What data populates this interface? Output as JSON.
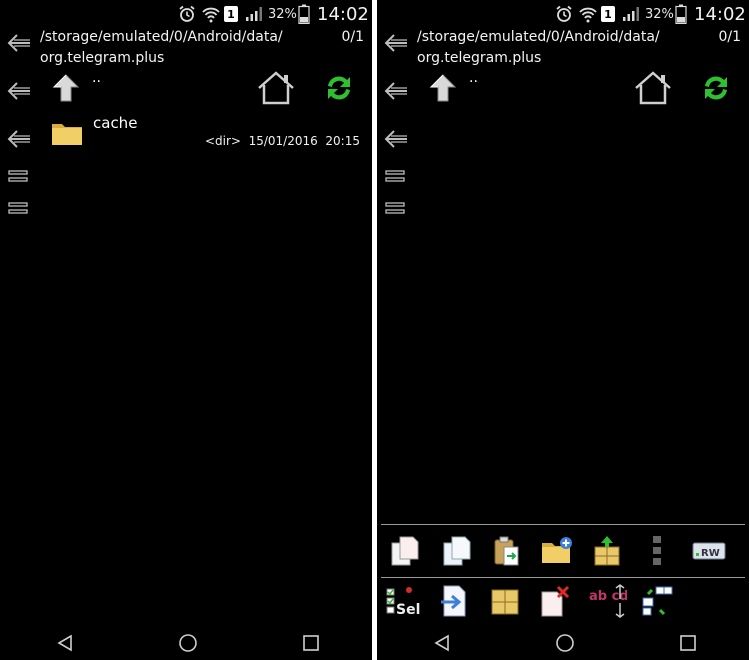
{
  "status_bar": {
    "battery_percent": "32%",
    "time": "14:02",
    "sim_label": "1",
    "icons": [
      "alarm-icon",
      "wifi-icon",
      "sim-icon",
      "signal-icon",
      "battery-icon"
    ]
  },
  "panels": [
    {
      "path": "/storage/emulated/0/Android/data/ org.telegram.plus",
      "count": "0/1",
      "up_label": "..",
      "items": [
        {
          "name": "cache",
          "type": "<dir>",
          "date": "15/01/2016",
          "time": "20:15"
        }
      ]
    },
    {
      "path": "/storage/emulated/0/Android/data/ org.telegram.plus",
      "count": "0/1",
      "up_label": "..",
      "items": []
    }
  ],
  "toolbar": {
    "row1": [
      "copy-icon",
      "copy-to-icon",
      "paste-icon",
      "new-folder-icon",
      "pack-icon",
      "more-icon",
      "rw-icon"
    ],
    "row2": [
      "select-icon",
      "move-icon",
      "archive-icon",
      "delete-icon",
      "rename-icon",
      "sort-icon"
    ],
    "rw_label": "RW",
    "sel_label": "Sel",
    "rename_label": "ab cd"
  },
  "colors": {
    "background": "#000000",
    "refresh_green": "#2fbf2f",
    "folder_yellow": "#f1cf66",
    "separator": "#9a9a9a"
  }
}
